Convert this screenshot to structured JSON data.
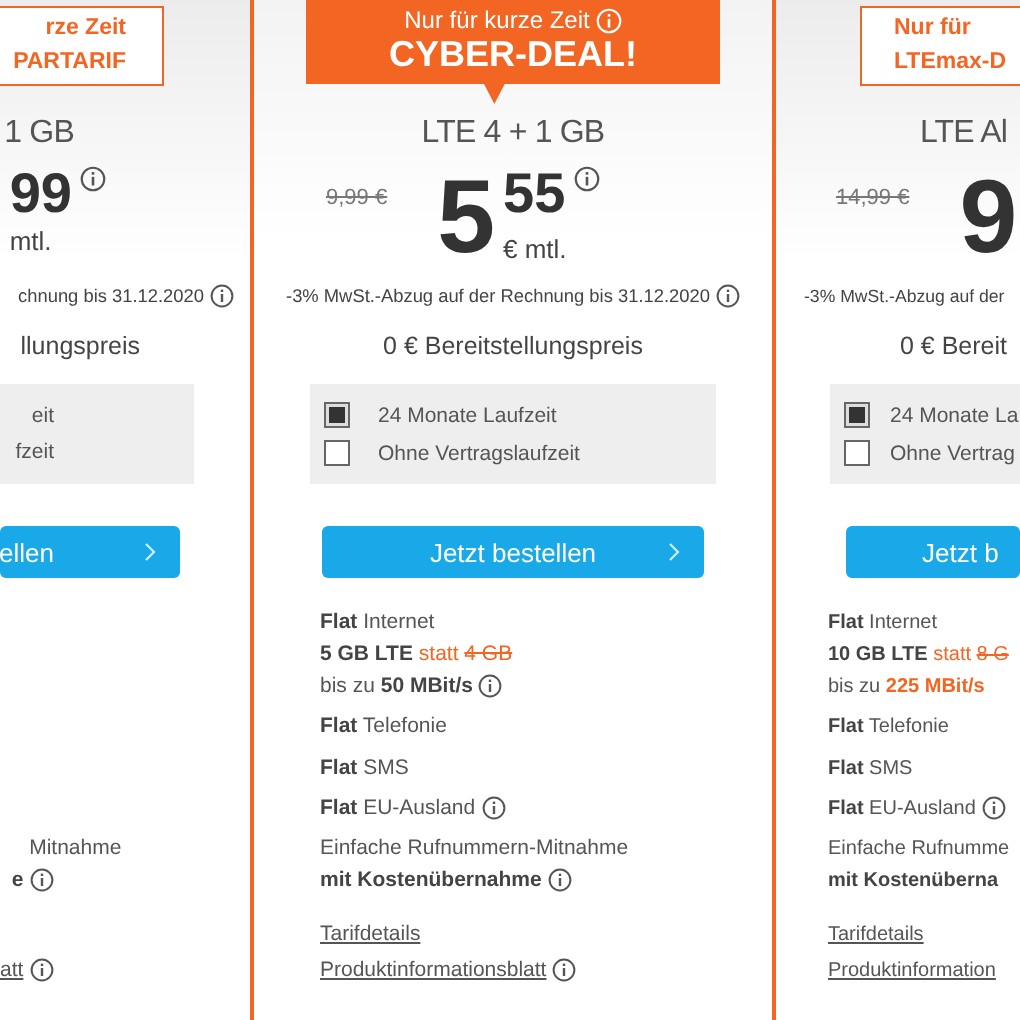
{
  "plans": [
    {
      "highlighted": false,
      "badge": {
        "lines": [
          "rze Zeit",
          "PARTARIF"
        ]
      },
      "name": "1 GB",
      "price": {
        "cents": "99",
        "info": true
      },
      "per": "mtl.",
      "vat_note": {
        "text": "chnung bis 31.12.2020",
        "info": true
      },
      "setup": "llungspreis",
      "terms": [
        {
          "label": "eit"
        },
        {
          "label": "fzeit"
        }
      ],
      "button": {
        "label": "ellen",
        "chevron": true
      },
      "features": [
        {
          "kind": "porting",
          "segments": [
            {
              "text": "Mitnahme"
            }
          ]
        },
        {
          "kind": "porting_cost",
          "segments": [
            {
              "text": "e",
              "kind": "bold"
            }
          ],
          "info": true
        }
      ],
      "links": [
        {
          "kind": "sheet",
          "label": "att",
          "info": true
        }
      ]
    },
    {
      "highlighted": true,
      "badge": {
        "lines": [
          "Nur für kurze Zeit",
          "CYBER-DEAL!"
        ],
        "info": true
      },
      "name": "LTE 4 + 1 GB",
      "old_price": "9,99 €",
      "price": {
        "whole": "5",
        "cents": "55",
        "info": true
      },
      "per": "€ mtl.",
      "vat_note": {
        "text": "-3% MwSt.-Abzug auf der Rechnung bis 31.12.2020",
        "info": true
      },
      "setup": "0 € Bereitstellungspreis",
      "terms": [
        {
          "label": "24 Monate Laufzeit",
          "selected": true
        },
        {
          "label": "Ohne Vertragslaufzeit",
          "selected": false
        }
      ],
      "button": {
        "label": "Jetzt bestellen",
        "chevron": true
      },
      "features": [
        {
          "kind": "internet",
          "segments": [
            {
              "text": "Flat",
              "kind": "bold"
            },
            {
              "text": " Internet"
            }
          ]
        },
        {
          "kind": "volume",
          "segments": [
            {
              "text": "5 GB LTE",
              "kind": "bold"
            },
            {
              "text": " statt ",
              "kind": "accent"
            },
            {
              "text": "4 GB",
              "kind": "struck"
            }
          ]
        },
        {
          "kind": "speed",
          "segments": [
            {
              "text": "bis zu "
            },
            {
              "text": "50 MBit/s",
              "kind": "bold"
            }
          ],
          "info": true
        },
        {
          "kind": "telefonie",
          "segments": [
            {
              "text": "Flat",
              "kind": "bold"
            },
            {
              "text": " Telefonie"
            }
          ]
        },
        {
          "kind": "sms",
          "segments": [
            {
              "text": "Flat",
              "kind": "bold"
            },
            {
              "text": " SMS"
            }
          ]
        },
        {
          "kind": "eu",
          "segments": [
            {
              "text": "Flat",
              "kind": "bold"
            },
            {
              "text": " EU-Ausland"
            }
          ],
          "info": true
        },
        {
          "kind": "porting",
          "segments": [
            {
              "text": "Einfache Rufnummern-Mitnahme"
            }
          ]
        },
        {
          "kind": "porting_cost",
          "segments": [
            {
              "text": "mit Kostenübernahme",
              "kind": "bold"
            }
          ],
          "info": true
        }
      ],
      "links": [
        {
          "kind": "details",
          "label": "Tarifdetails"
        },
        {
          "kind": "sheet",
          "label": "Produktinformationsblatt",
          "info": true
        }
      ]
    },
    {
      "highlighted": false,
      "badge": {
        "lines": [
          "Nur für",
          "LTEmax-D"
        ]
      },
      "name": "LTE Al",
      "old_price": "14,99 €",
      "price": {
        "whole": "9"
      },
      "vat_note": {
        "text": "-3% MwSt.-Abzug auf der"
      },
      "setup": "0 € Bereit",
      "terms": [
        {
          "label": "24 Monate La",
          "selected": true
        },
        {
          "label": "Ohne Vertrag",
          "selected": false
        }
      ],
      "button": {
        "label": "Jetzt b"
      },
      "features": [
        {
          "kind": "internet",
          "segments": [
            {
              "text": "Flat",
              "kind": "bold"
            },
            {
              "text": " Internet"
            }
          ]
        },
        {
          "kind": "volume",
          "segments": [
            {
              "text": "10 GB LTE",
              "kind": "bold"
            },
            {
              "text": " statt ",
              "kind": "accent"
            },
            {
              "text": "8 G",
              "kind": "struck"
            }
          ]
        },
        {
          "kind": "speed",
          "segments": [
            {
              "text": "bis zu "
            },
            {
              "text": "225 MBit/s",
              "kind": "bold-accent"
            }
          ]
        },
        {
          "kind": "telefonie",
          "segments": [
            {
              "text": "Flat",
              "kind": "bold"
            },
            {
              "text": " Telefonie"
            }
          ]
        },
        {
          "kind": "sms",
          "segments": [
            {
              "text": "Flat",
              "kind": "bold"
            },
            {
              "text": " SMS"
            }
          ]
        },
        {
          "kind": "eu",
          "segments": [
            {
              "text": "Flat",
              "kind": "bold"
            },
            {
              "text": " EU-Ausland"
            }
          ],
          "info": true
        },
        {
          "kind": "porting",
          "segments": [
            {
              "text": "Einfache Rufnumme"
            }
          ]
        },
        {
          "kind": "porting_cost",
          "segments": [
            {
              "text": "mit Kostenüberna",
              "kind": "bold"
            }
          ]
        }
      ],
      "links": [
        {
          "kind": "details",
          "label": "Tarifdetails"
        },
        {
          "kind": "sheet",
          "label": "Produktinformation"
        }
      ]
    }
  ]
}
